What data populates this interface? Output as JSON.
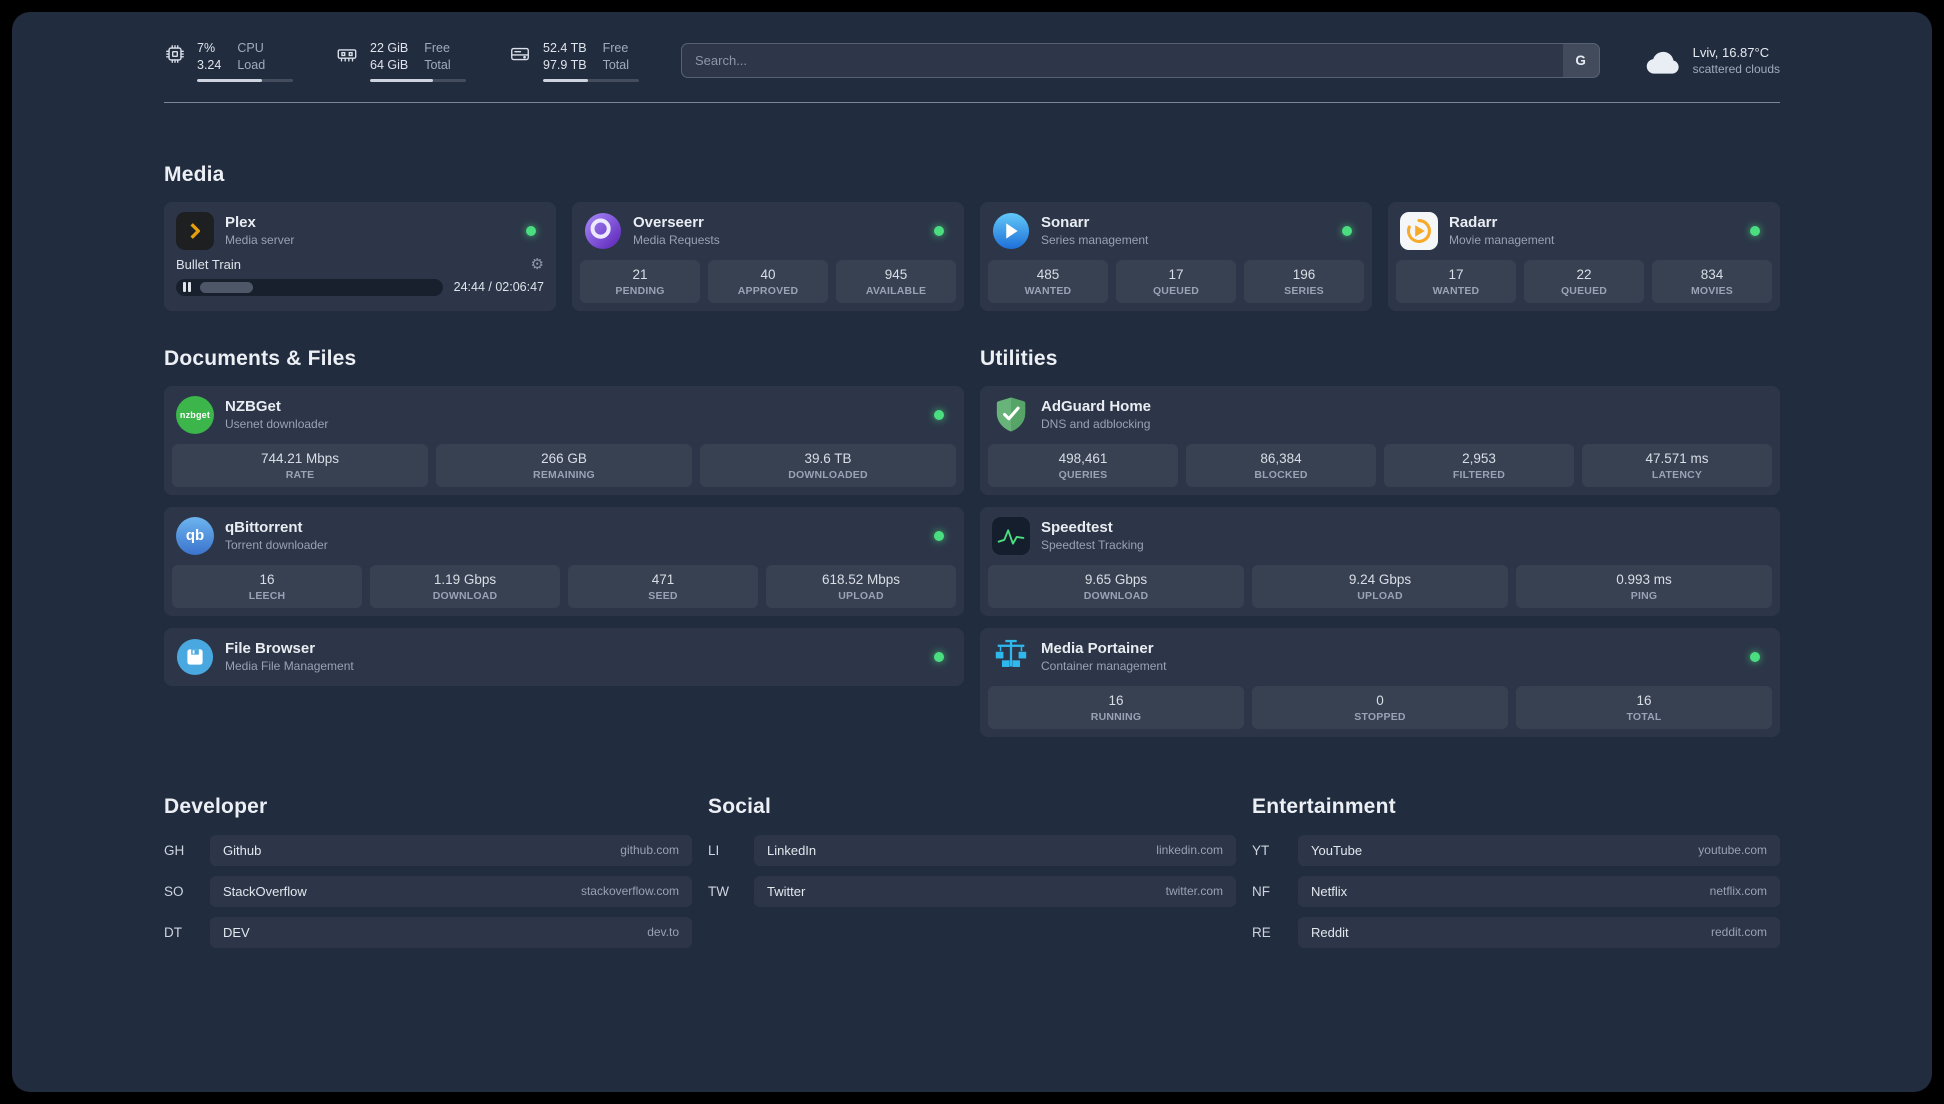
{
  "colors": {
    "status_online": "#4ade80",
    "background": "#212c3f"
  },
  "icons": {
    "gear_glyph": "⚙",
    "nzbget_glyph": "nzbget",
    "qbittorrent_glyph": "qb"
  },
  "topbar": {
    "cpu": {
      "values": [
        "7%",
        "3.24"
      ],
      "labels": [
        "CPU",
        "Load"
      ],
      "progress": 68
    },
    "memory": {
      "values": [
        "22 GiB",
        "64 GiB"
      ],
      "labels": [
        "Free",
        "Total"
      ],
      "progress": 66
    },
    "disk": {
      "values": [
        "52.4 TB",
        "97.9 TB"
      ],
      "labels": [
        "Free",
        "Total"
      ],
      "progress": 47
    },
    "search": {
      "placeholder": "Search...",
      "button_label": "G"
    },
    "weather": {
      "location": "Lviv, 16.87°C",
      "condition": "scattered clouds"
    }
  },
  "media": {
    "title": "Media",
    "plex": {
      "name": "Plex",
      "desc": "Media server",
      "track": "Bullet Train",
      "time": "24:44 / 02:06:47",
      "progress": 20
    },
    "overseerr": {
      "name": "Overseerr",
      "desc": "Media Requests",
      "stats": [
        {
          "value": "21",
          "label": "PENDING"
        },
        {
          "value": "40",
          "label": "APPROVED"
        },
        {
          "value": "945",
          "label": "AVAILABLE"
        }
      ]
    },
    "sonarr": {
      "name": "Sonarr",
      "desc": "Series management",
      "stats": [
        {
          "value": "485",
          "label": "WANTED"
        },
        {
          "value": "17",
          "label": "QUEUED"
        },
        {
          "value": "196",
          "label": "SERIES"
        }
      ]
    },
    "radarr": {
      "name": "Radarr",
      "desc": "Movie management",
      "stats": [
        {
          "value": "17",
          "label": "WANTED"
        },
        {
          "value": "22",
          "label": "QUEUED"
        },
        {
          "value": "834",
          "label": "MOVIES"
        }
      ]
    }
  },
  "documents": {
    "title": "Documents & Files",
    "nzbget": {
      "name": "NZBGet",
      "desc": "Usenet downloader",
      "stats": [
        {
          "value": "744.21 Mbps",
          "label": "RATE"
        },
        {
          "value": "266 GB",
          "label": "REMAINING"
        },
        {
          "value": "39.6 TB",
          "label": "DOWNLOADED"
        }
      ]
    },
    "qbittorrent": {
      "name": "qBittorrent",
      "desc": "Torrent downloader",
      "stats": [
        {
          "value": "16",
          "label": "LEECH"
        },
        {
          "value": "1.19 Gbps",
          "label": "DOWNLOAD"
        },
        {
          "value": "471",
          "label": "SEED"
        },
        {
          "value": "618.52 Mbps",
          "label": "UPLOAD"
        }
      ]
    },
    "filebrowser": {
      "name": "File Browser",
      "desc": "Media File Management"
    }
  },
  "utilities": {
    "title": "Utilities",
    "adguard": {
      "name": "AdGuard Home",
      "desc": "DNS and adblocking",
      "stats": [
        {
          "value": "498,461",
          "label": "QUERIES"
        },
        {
          "value": "86,384",
          "label": "BLOCKED"
        },
        {
          "value": "2,953",
          "label": "FILTERED"
        },
        {
          "value": "47.571 ms",
          "label": "LATENCY"
        }
      ]
    },
    "speedtest": {
      "name": "Speedtest",
      "desc": "Speedtest Tracking",
      "stats": [
        {
          "value": "9.65 Gbps",
          "label": "DOWNLOAD"
        },
        {
          "value": "9.24 Gbps",
          "label": "UPLOAD"
        },
        {
          "value": "0.993 ms",
          "label": "PING"
        }
      ]
    },
    "portainer": {
      "name": "Media Portainer",
      "desc": "Container management",
      "stats": [
        {
          "value": "16",
          "label": "RUNNING"
        },
        {
          "value": "0",
          "label": "STOPPED"
        },
        {
          "value": "16",
          "label": "TOTAL"
        }
      ]
    }
  },
  "bookmarks": [
    {
      "title": "Developer",
      "items": [
        {
          "abbr": "GH",
          "name": "Github",
          "url": "github.com"
        },
        {
          "abbr": "SO",
          "name": "StackOverflow",
          "url": "stackoverflow.com"
        },
        {
          "abbr": "DT",
          "name": "DEV",
          "url": "dev.to"
        }
      ]
    },
    {
      "title": "Social",
      "items": [
        {
          "abbr": "LI",
          "name": "LinkedIn",
          "url": "linkedin.com"
        },
        {
          "abbr": "TW",
          "name": "Twitter",
          "url": "twitter.com"
        }
      ]
    },
    {
      "title": "Entertainment",
      "items": [
        {
          "abbr": "YT",
          "name": "YouTube",
          "url": "youtube.com"
        },
        {
          "abbr": "NF",
          "name": "Netflix",
          "url": "netflix.com"
        },
        {
          "abbr": "RE",
          "name": "Reddit",
          "url": "reddit.com"
        }
      ]
    }
  ]
}
